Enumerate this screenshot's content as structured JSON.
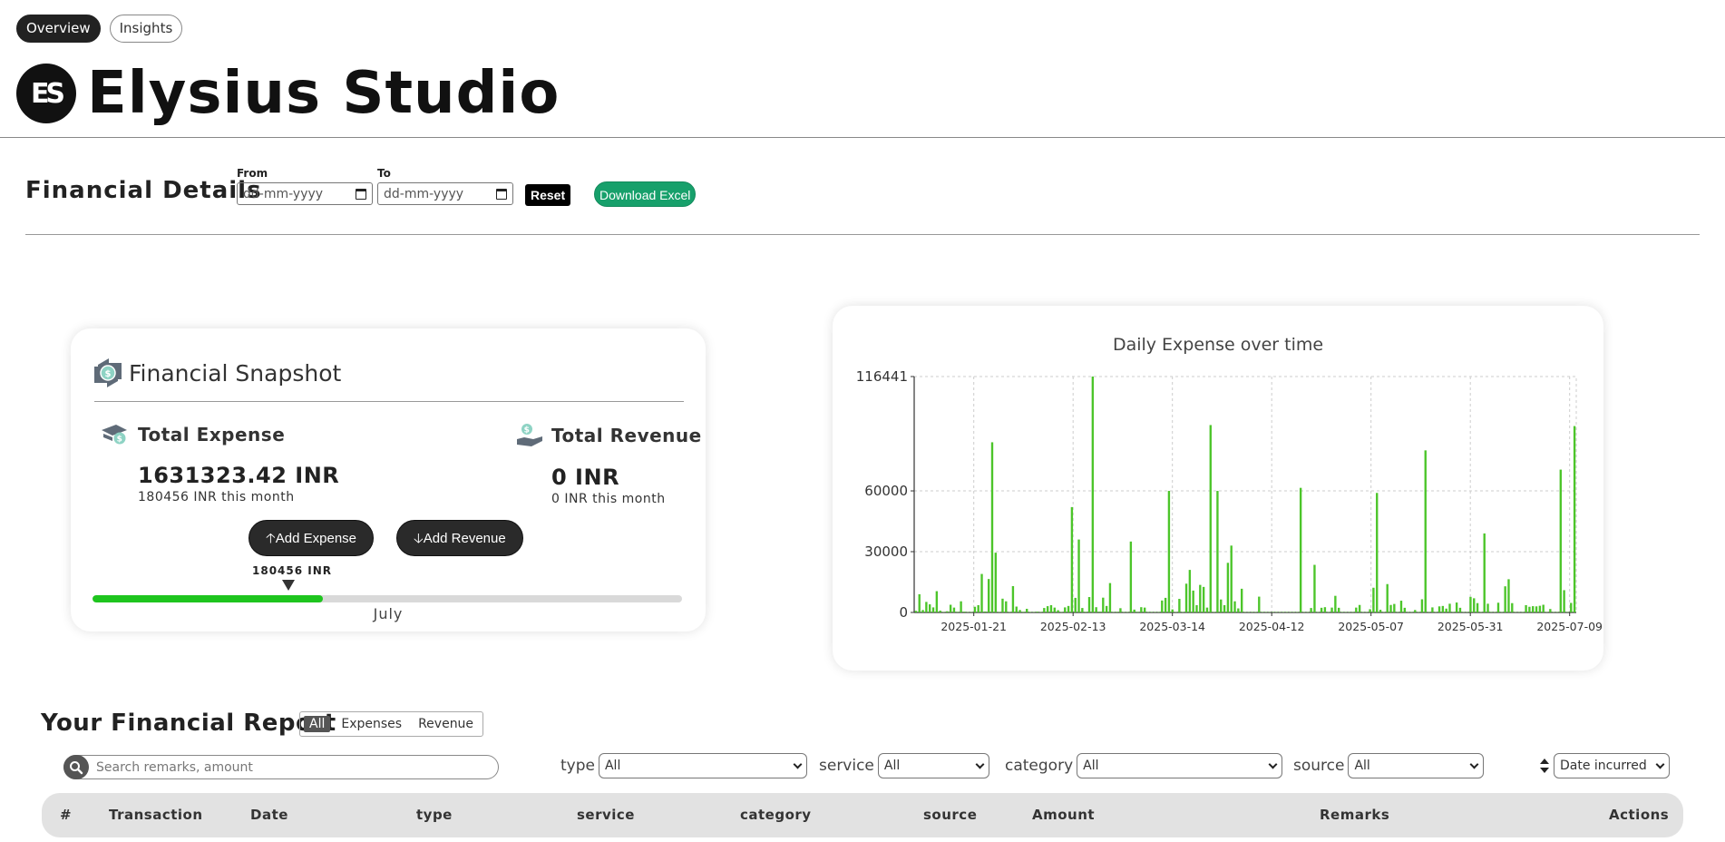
{
  "nav": {
    "tabs": [
      "Overview",
      "Insights"
    ]
  },
  "brand": {
    "logo_text": "ES",
    "name": "Elysius Studio"
  },
  "filters_bar": {
    "title": "Financial Details",
    "from_label": "From",
    "to_label": "To",
    "from_placeholder": "dd-mm-yyyy",
    "to_placeholder": "dd-mm-yyyy",
    "reset_label": "Reset",
    "download_label": "Download Excel"
  },
  "snapshot": {
    "title": "Financial Snapshot",
    "expense": {
      "label": "Total Expense",
      "value": "1631323.42 INR",
      "sub": "180456 INR this month"
    },
    "revenue": {
      "label": "Total Revenue",
      "value": "0 INR",
      "sub": "0 INR this month"
    },
    "add_expense_label": "Add Expense",
    "add_revenue_label": "Add Revenue",
    "marker_label": "180456 INR",
    "progress_fraction": 0.39,
    "month": "July"
  },
  "chart_data": {
    "type": "bar",
    "title": "Daily Expense over time",
    "xlabel": "",
    "ylabel": "",
    "ylim": [
      0,
      116441
    ],
    "yticks": [
      0,
      30000,
      60000,
      116441
    ],
    "xtick_labels": [
      "2025-01-21",
      "2025-02-13",
      "2025-03-14",
      "2025-04-12",
      "2025-05-07",
      "2025-05-31",
      "2025-07-09"
    ],
    "color": "#4cc52a",
    "values": [
      800,
      9000,
      1200,
      5200,
      4000,
      2500,
      10500,
      900,
      200,
      600,
      3800,
      2400,
      300,
      5500,
      400,
      200,
      200,
      2800,
      3600,
      19000,
      500,
      16500,
      84000,
      29500,
      200,
      6800,
      5500,
      200,
      13000,
      2900,
      1200,
      300,
      1800,
      200,
      200,
      400,
      200,
      2200,
      3100,
      3600,
      2400,
      1100,
      200,
      2500,
      3200,
      52000,
      7200,
      36000,
      2200,
      300,
      7600,
      116441,
      2600,
      400,
      7300,
      3200,
      14500,
      200,
      300,
      2100,
      200,
      200,
      35000,
      1400,
      300,
      2600,
      2400,
      200,
      200,
      200,
      200,
      5900,
      7200,
      60000,
      1500,
      200,
      6700,
      200,
      14200,
      21000,
      10800,
      3600,
      13600,
      12600,
      2400,
      92500,
      200,
      60000,
      6400,
      3600,
      24500,
      33000,
      5500,
      2000,
      11700,
      200,
      200,
      200,
      200,
      7800,
      200,
      200,
      200,
      200,
      200,
      200,
      200,
      200,
      200,
      200,
      200,
      61500,
      200,
      200,
      2200,
      23500,
      200,
      2300,
      2600,
      200,
      2400,
      8200,
      2300,
      200,
      200,
      200,
      200,
      2400,
      3700,
      200,
      200,
      1600,
      12200,
      59000,
      1300,
      200,
      14000,
      3700,
      4200,
      200,
      5800,
      2300,
      200,
      200,
      1200,
      200,
      6500,
      80000,
      200,
      2500,
      200,
      3000,
      3200,
      1900,
      4300,
      200,
      4900,
      2300,
      200,
      200,
      7700,
      7000,
      4600,
      200,
      39000,
      4300,
      200,
      200,
      4800,
      200,
      12900,
      16400,
      4600,
      200,
      200,
      200,
      3600,
      2800,
      3100,
      3000,
      3300,
      3800,
      200,
      1700,
      200,
      200,
      70500,
      11000,
      200,
      4700,
      92000
    ]
  },
  "report": {
    "title": "Your Financial Report",
    "segments": [
      "All",
      "Expenses",
      "Revenue"
    ],
    "search_placeholder": "Search remarks, amount",
    "filters": {
      "type": {
        "label": "type",
        "value": "All"
      },
      "service": {
        "label": "service",
        "value": "All"
      },
      "category": {
        "label": "category",
        "value": "All"
      },
      "source": {
        "label": "source",
        "value": "All"
      }
    },
    "sort_value": "Date incurred",
    "columns": [
      "#",
      "Transaction",
      "Date",
      "type",
      "service",
      "category",
      "source",
      "Amount",
      "Remarks",
      "Actions"
    ]
  }
}
